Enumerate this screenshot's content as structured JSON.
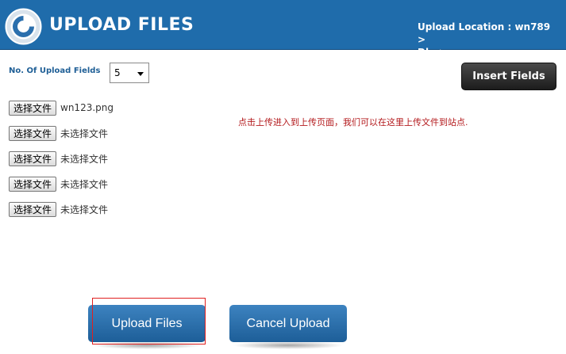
{
  "header": {
    "title": "UPLOAD FILES",
    "location_line1": "Upload Location : wn789 >",
    "location_line2": "Dlq >"
  },
  "controls": {
    "fields_label": "No. Of Upload Fields",
    "fields_count": "5",
    "insert_label": "Insert Fields"
  },
  "files": [
    {
      "button": "选择文件",
      "status": "wn123.png"
    },
    {
      "button": "选择文件",
      "status": "未选择文件"
    },
    {
      "button": "选择文件",
      "status": "未选择文件"
    },
    {
      "button": "选择文件",
      "status": "未选择文件"
    },
    {
      "button": "选择文件",
      "status": "未选择文件"
    }
  ],
  "hint": "点击上传进入到上传页面，我们可以在这里上传文件到站点.",
  "actions": {
    "upload_label": "Upload Files",
    "cancel_label": "Cancel Upload"
  },
  "colors": {
    "header_bg": "#1f6cab",
    "hint_text": "#b3181b",
    "button_blue": "#2a6fad"
  },
  "icons": {
    "logo": "app-logo-icon",
    "select_arrow": "chevron-down-icon"
  }
}
